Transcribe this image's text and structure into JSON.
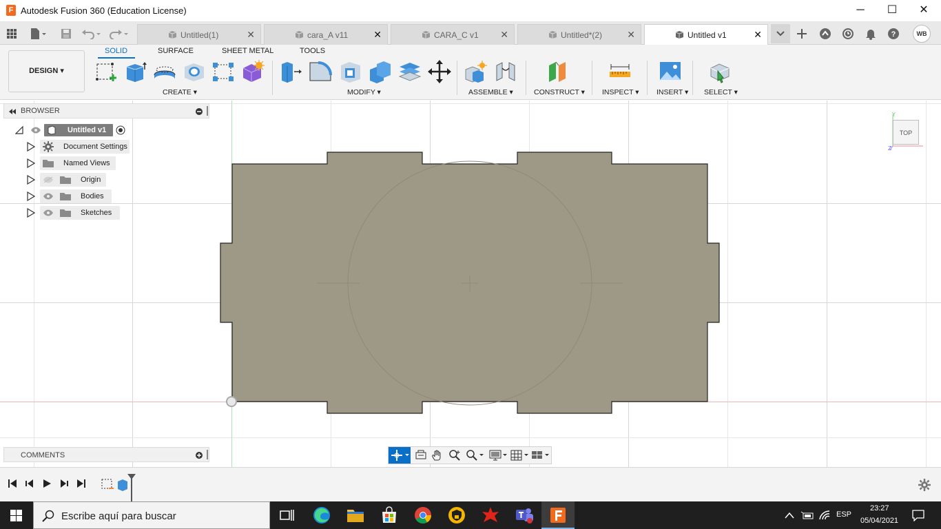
{
  "window": {
    "title": "Autodesk Fusion 360 (Education License)",
    "logo_letter": "F",
    "minimize_glyph": "─",
    "maximize_glyph": "☐",
    "close_glyph": "✕"
  },
  "tabs": [
    {
      "label": "Untitled(1)",
      "active": false
    },
    {
      "label": "cara_A v11",
      "active": false
    },
    {
      "label": "CARA_C v1",
      "active": false
    },
    {
      "label": "Untitled*(2)",
      "active": false
    },
    {
      "label": "Untitled v1",
      "active": true
    }
  ],
  "tab_close_glyph": "✕",
  "user_initials": "WB",
  "ribbon": {
    "workspace": "DESIGN ▾",
    "tabs": [
      "SOLID",
      "SURFACE",
      "SHEET METAL",
      "TOOLS"
    ],
    "groups": [
      "CREATE ▾",
      "MODIFY ▾",
      "ASSEMBLE ▾",
      "CONSTRUCT ▾",
      "INSPECT ▾",
      "INSERT ▾",
      "SELECT ▾"
    ]
  },
  "browser": {
    "title": "BROWSER",
    "root": "Untitled v1",
    "items": [
      "Document Settings",
      "Named Views",
      "Origin",
      "Bodies",
      "Sketches"
    ]
  },
  "comments": {
    "title": "COMMENTS"
  },
  "viewcube": {
    "face": "TOP"
  },
  "taskbar": {
    "search_placeholder": "Escribe aquí para buscar",
    "language": "ESP",
    "time": "23:27",
    "date": "05/04/2021"
  },
  "colors": {
    "accent": "#0a6fc6",
    "part_fill": "#9e9886",
    "fusion_orange": "#f26b1d"
  }
}
